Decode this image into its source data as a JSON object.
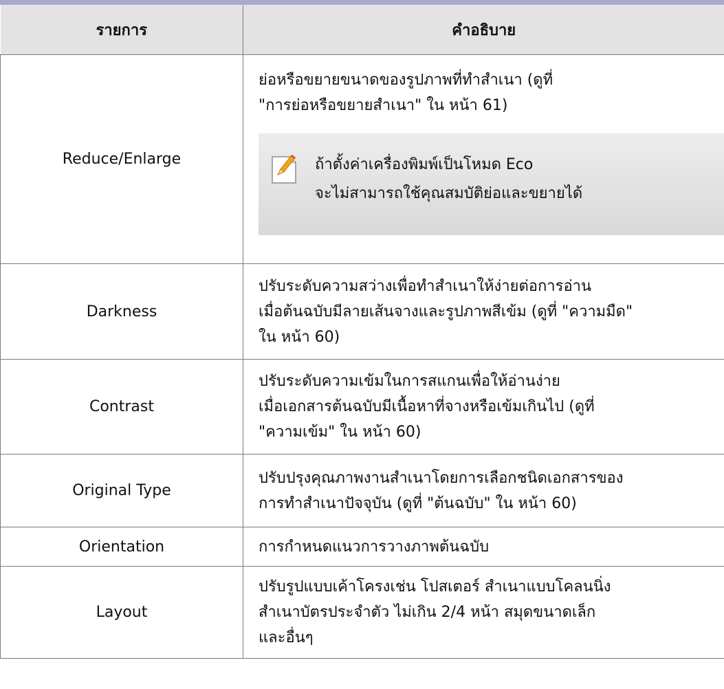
{
  "header": {
    "col_item": "รายการ",
    "col_desc": "คำอธิบาย"
  },
  "rows": {
    "reduce": {
      "name": "Reduce/Enlarge",
      "desc": [
        "ย่อหรือขยายขนาดของรูปภาพที่ทำสำเนา (ดูที่",
        "\"การย่อหรือขยายสำเนา\"  ใน หน้า 61)"
      ],
      "note": [
        "ถ้าตั้งค่าเครื่องพิมพ์เป็นโหมด Eco",
        "จะไม่สามารถใช้คุณสมบัติย่อและขยายได้"
      ],
      "note_icon": "note-pencil-icon"
    },
    "darkness": {
      "name": "Darkness",
      "desc": [
        "ปรับระดับความสว่างเพื่อทำสำเนาให้ง่ายต่อการอ่าน",
        "เมื่อต้นฉบับมีลายเส้นจางและรูปภาพสีเข้ม (ดูที่ \"ความมืด\"",
        "ใน หน้า 60)"
      ]
    },
    "contrast": {
      "name": "Contrast",
      "desc": [
        "ปรับระดับความเข้มในการสแกนเพื่อให้อ่านง่าย",
        "เมื่อเอกสารต้นฉบับมีเนื้อหาที่จางหรือเข้มเกินไป (ดูที่",
        "\"ความเข้ม\"  ใน หน้า 60)"
      ]
    },
    "original_type": {
      "name": "Original Type",
      "desc": [
        "ปรับปรุงคุณภาพงานสำเนาโดยการเลือกชนิดเอกสารของ",
        "การทำสำเนาปัจจุบัน (ดูที่ \"ต้นฉบับ\"  ใน หน้า 60)"
      ]
    },
    "orientation": {
      "name": "Orientation",
      "desc": [
        "การกำหนดแนวการวางภาพต้นฉบับ"
      ]
    },
    "layout": {
      "name": "Layout",
      "desc": [
        "ปรับรูปแบบเค้าโครงเช่น โปสเตอร์ สำเนาแบบโคลนนิ่ง",
        "สำเนาบัตรประจำตัว ไม่เกิน 2/4 หน้า สมุดขนาดเล็ก",
        "และอื่นๆ"
      ]
    }
  },
  "colors": {
    "top_bar": "#a9a9cf",
    "header_bg": "#e3e3e3",
    "note_bg": "#e4e4e4",
    "rule": "#7a7a7a",
    "icon_pencil": "#f2a51a"
  }
}
